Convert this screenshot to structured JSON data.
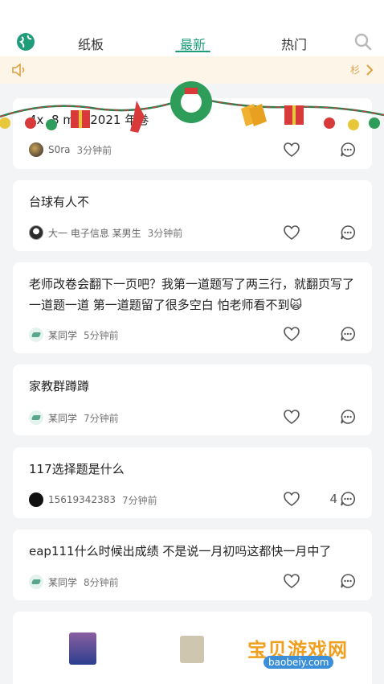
{
  "nav": {
    "tabs": [
      {
        "label": "纸板"
      },
      {
        "label": "最新"
      },
      {
        "label": "热门"
      }
    ],
    "active_color": "#1f9d7a"
  },
  "notice": {
    "trail_text": "杉"
  },
  "posts": [
    {
      "title": "4x .8 mm 2021 年卷",
      "author": "S0ra",
      "time": "3分钟前",
      "avatar": "photo",
      "count": ""
    },
    {
      "title": "台球有人不",
      "author": "大一 电子信息 某男生",
      "time": "3分钟前",
      "avatar": "bw",
      "count": ""
    },
    {
      "title": "老师改卷会翻下一页吧？我第一道题写了两三行，就翻页写了 一道题一道 第一道题留了很多空白 怕老师看不到🙀",
      "author": "某同学",
      "time": "5分钟前",
      "avatar": "green",
      "count": ""
    },
    {
      "title": "家教群蹲蹲",
      "author": "某同学",
      "time": "7分钟前",
      "avatar": "green",
      "count": ""
    },
    {
      "title": "117选择题是什么",
      "author": "15619342383",
      "time": "7分钟前",
      "avatar": "black",
      "count": "4"
    },
    {
      "title": "eap111什么时候出成绩 不是说一月初吗这都快一月中了",
      "author": "某同学",
      "time": "8分钟前",
      "avatar": "green",
      "count": ""
    }
  ],
  "watermark": {
    "text": "宝贝游戏网",
    "url": "baobeiy.com"
  },
  "icons": {
    "globe": "globe-icon",
    "search": "search-icon",
    "speaker": "speaker-icon",
    "heart": "heart-icon",
    "comment": "comment-icon"
  }
}
